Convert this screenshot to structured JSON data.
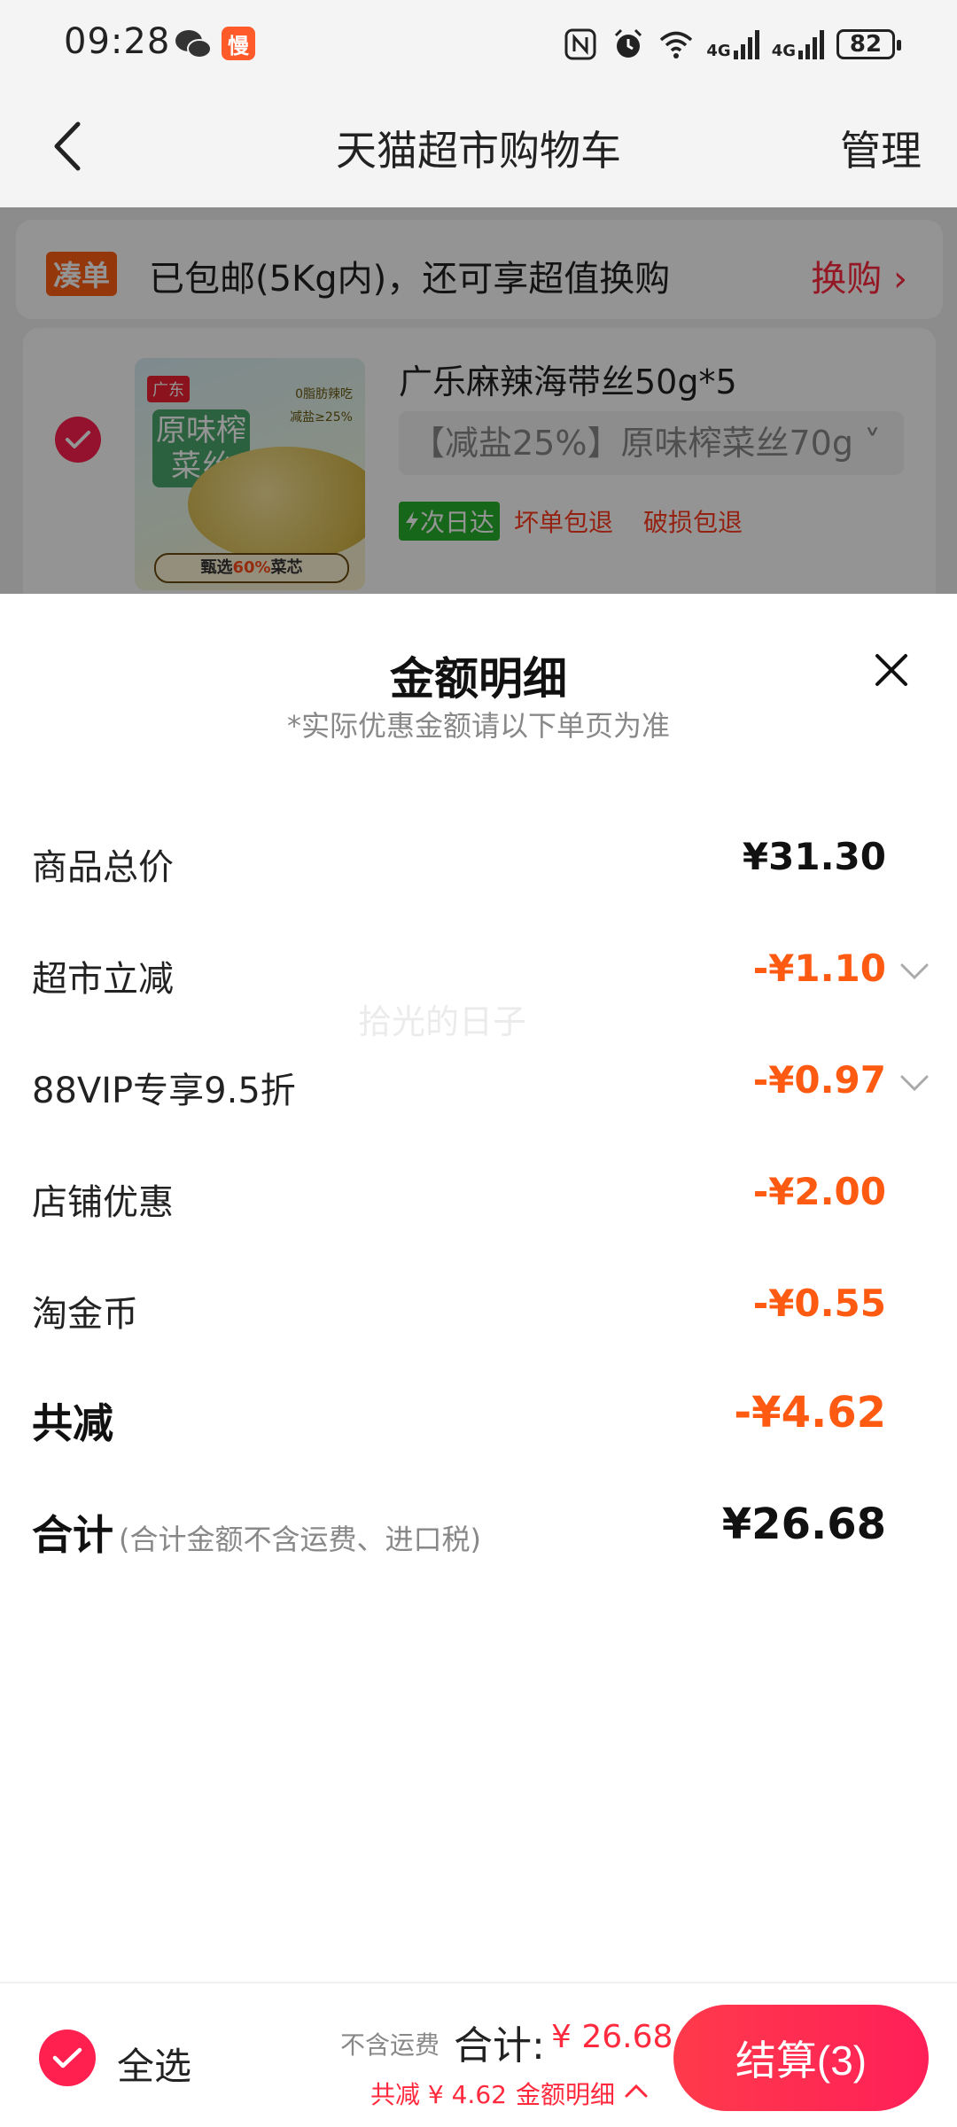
{
  "status_bar": {
    "time": "09:28",
    "app_badge": "慢",
    "battery": "82",
    "net1": "4G",
    "net2": "4G"
  },
  "nav": {
    "title": "天猫超市购物车",
    "manage": "管理"
  },
  "cart": {
    "promo_tag": "凑单",
    "promo_text": "已包邮(5Kg内)，还可享超值换购",
    "promo_link": "换购 ›",
    "item": {
      "thumb_brand": "广东",
      "thumb_title": "原味榨菜丝",
      "thumb_badge1": "0脂肪辣吃",
      "thumb_badge2": "减盐≥25%",
      "thumb_banner_prefix": "甄选",
      "thumb_banner_highlight": "60%",
      "thumb_banner_suffix": "菜芯",
      "name": "广乐麻辣海带丝50g*5",
      "sku": "【减盐25%】原味榨菜丝70g ˅",
      "tag_next_day": "次日达",
      "tag_bad": "坏单包退",
      "tag_broken": "破损包退"
    }
  },
  "sheet": {
    "title": "金额明细",
    "subtitle": "*实际优惠金额请以下单页为准",
    "watermark": "拾光的日子",
    "rows": [
      {
        "label": "商品总价",
        "value": "¥31.30"
      },
      {
        "label": "超市立减",
        "value": "-¥1.10"
      },
      {
        "label": "88VIP专享9.5折",
        "value": "-¥0.97"
      },
      {
        "label": "店铺优惠",
        "value": "-¥2.00"
      },
      {
        "label": "淘金币",
        "value": "-¥0.55"
      },
      {
        "label": "共减",
        "value": "-¥4.62"
      },
      {
        "label": "合计",
        "note": "(合计金额不含运费、进口税)",
        "value": "¥26.68"
      }
    ]
  },
  "bottom_bar": {
    "select_all": "全选",
    "shipping_note": "不含运费",
    "total_label": "合计:",
    "total_value": "¥ 26.68",
    "saving": "共减 ¥ 4.62",
    "detail_link": "金额明细",
    "checkout": "结算(3)"
  },
  "colors": {
    "accent": "#ff2050",
    "discount": "#ff5a12",
    "price_red": "#ff2a3e"
  }
}
